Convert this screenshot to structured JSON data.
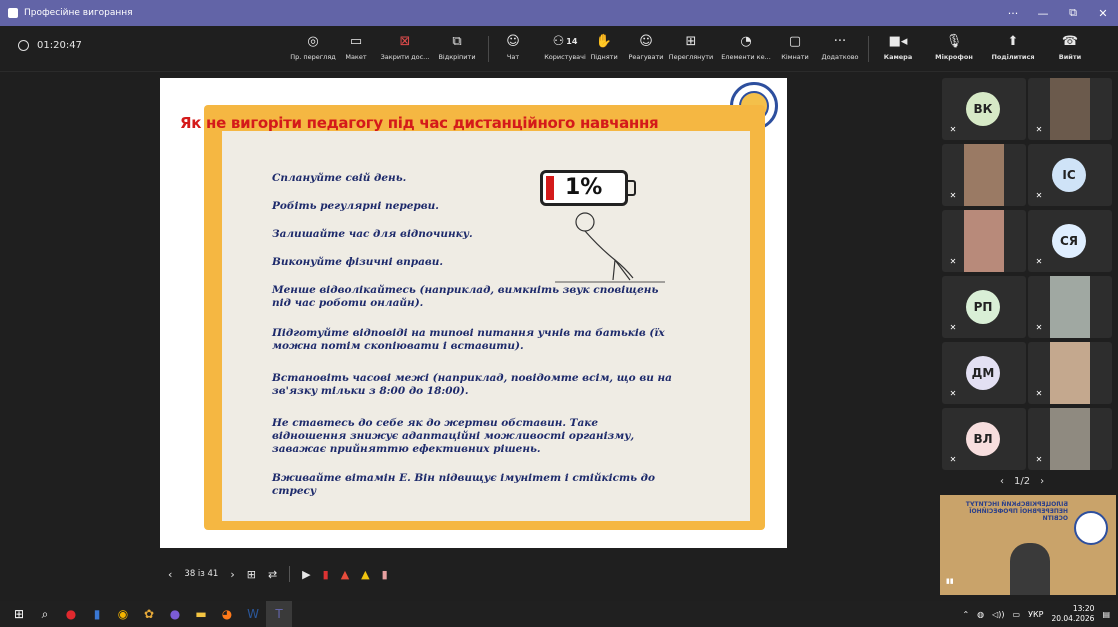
{
  "window": {
    "title": "Професійне вигорання",
    "controls": [
      "···",
      "—",
      "⧉",
      "✕"
    ]
  },
  "meeting": {
    "timer": "01:20:47",
    "participant_count": "14",
    "tools": [
      {
        "icon": "view-icon",
        "label": "Пр. перегляд"
      },
      {
        "icon": "layout-icon",
        "label": "Макет"
      },
      {
        "icon": "close-share-icon",
        "label": "Закрити дос..."
      },
      {
        "icon": "unpin-icon",
        "label": "Відкріпити"
      },
      {
        "icon": "chat-icon",
        "label": "Чат"
      },
      {
        "icon": "people-icon",
        "label": "Користувачі"
      },
      {
        "icon": "raise-hand-icon",
        "label": "Підняти"
      },
      {
        "icon": "react-icon",
        "label": "Реагувати"
      },
      {
        "icon": "view-grid-icon",
        "label": "Переглянути"
      },
      {
        "icon": "elements-icon",
        "label": "Елементи ке..."
      },
      {
        "icon": "rooms-icon",
        "label": "Кімнати"
      },
      {
        "icon": "more-icon",
        "label": "Додатково"
      },
      {
        "icon": "camera-icon",
        "label": "Камера"
      },
      {
        "icon": "mic-icon",
        "label": "Мікрофон"
      },
      {
        "icon": "share-icon",
        "label": "Поділитися"
      },
      {
        "icon": "leave-icon",
        "label": "Вийти"
      }
    ]
  },
  "slide": {
    "title": "Як не вигоріти педагогу під час дистанційного навчання",
    "battery_text": "1%",
    "tips": [
      "Сплануйте свій день.",
      "Робіть регулярні перерви.",
      "Залишайте час для відпочинку.",
      "Виконуйте фізичні вправи.",
      "Менше відволікайтесь (наприклад, вимкніть звук сповіщень під час роботи онлайн).",
      "Підготуйте відповіді на типові питання учнів та батьків (їх можна потім скопіювати і вставити).",
      "Встановіть часові межі (наприклад, повідомте всім, що ви на зв'язку тільки з 8:00 до 18:00).",
      "Не ставтесь до себе як до жертви обставин. Таке відношення знижує адаптаційні можливості організму, заважає прийняттю ефективних рішень.",
      "Вживайте вітамін Е. Він підвищує імунітет і стійкість до стресу"
    ]
  },
  "slide_controls": {
    "page": "38 із 41"
  },
  "participants": [
    {
      "initials": "ВК",
      "color": "#d6e9c6"
    },
    {
      "initials": "",
      "photo": true
    },
    {
      "initials": "",
      "photo": true
    },
    {
      "initials": "ІС",
      "color": "#cfe3f7"
    },
    {
      "initials": "",
      "photo": true
    },
    {
      "initials": "СЯ",
      "color": "#dfeeff"
    },
    {
      "initials": "РП",
      "color": "#d9efd6"
    },
    {
      "initials": "",
      "photo": true
    },
    {
      "initials": "ДМ",
      "color": "#e3e0f3"
    },
    {
      "initials": "",
      "photo": true
    },
    {
      "initials": "ВЛ",
      "color": "#f7dede"
    },
    {
      "initials": "",
      "photo": true
    }
  ],
  "pager": {
    "text": "1/2"
  },
  "self_view": {
    "banner": "БІЛОЦЕРКІВСЬКИЙ ІНСТИТУТ НЕПЕРЕРВНОЇ ПРОФЕСІЙНОЇ ОСВІТИ"
  },
  "taskbar": {
    "lang": "УКР",
    "time": "13:20",
    "date": "20.04.2026"
  }
}
